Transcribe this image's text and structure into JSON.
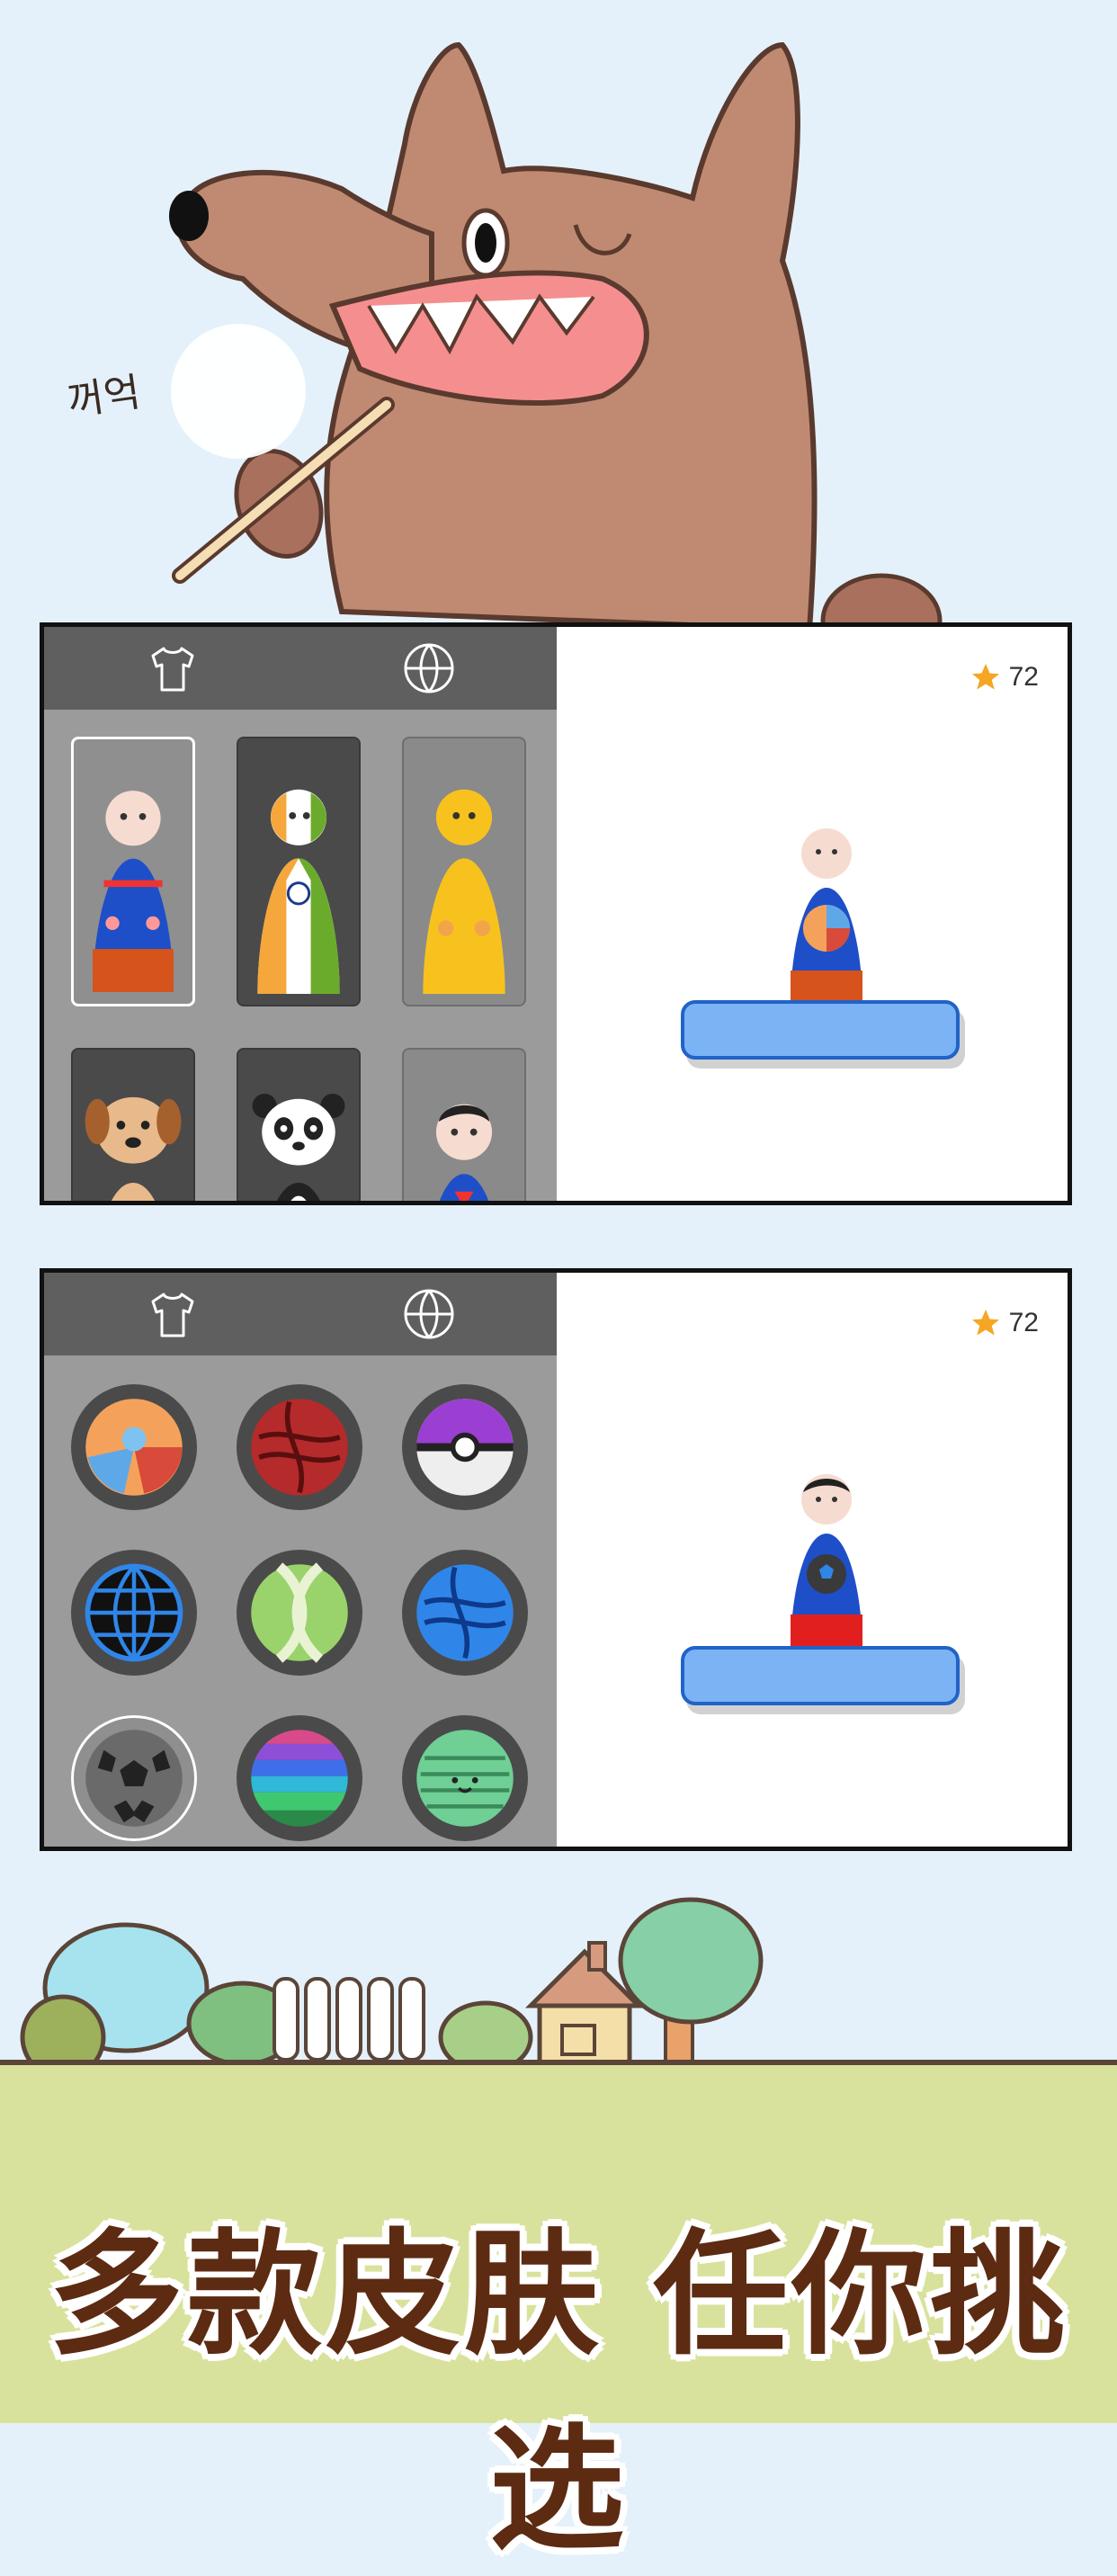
{
  "panels": [
    {
      "coins": "72",
      "tabs": [
        {
          "icon": "shirt-icon"
        },
        {
          "icon": "basketball-icon"
        }
      ],
      "active_tab": "skins",
      "skins": [
        "plain-blue",
        "india",
        "yellow-chick",
        "dog",
        "panda",
        "superman"
      ],
      "selected_skin": "plain-blue"
    },
    {
      "coins": "72",
      "tabs": [
        {
          "icon": "shirt-icon"
        },
        {
          "icon": "basketball-icon"
        }
      ],
      "active_tab": "balls",
      "balls": [
        "beach-ball",
        "red-volleyball",
        "purple-pokeball",
        "blue-globe",
        "green-tennis",
        "blue-volleyball",
        "soccer-ball",
        "rainbow-ball",
        "green-smile-ball"
      ],
      "selected_ball": "soccer-ball"
    }
  ],
  "speech_bubble": "꺼억",
  "slogan": "多款皮肤 任你挑选",
  "colors": {
    "sky": "#e4f1fb",
    "panel_sidebar": "#9b9b9b",
    "tab_bar": "#5f5f5f",
    "platform": "#7cb3f4",
    "slogan": "#5c2b12",
    "star": "#f5a623"
  }
}
